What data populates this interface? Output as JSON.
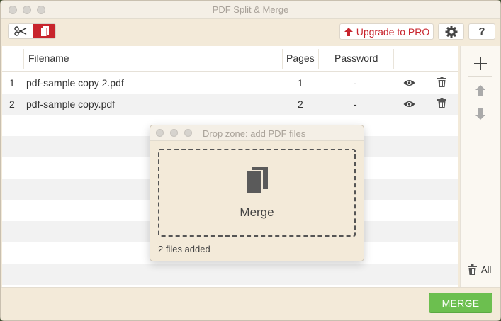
{
  "window": {
    "title": "PDF Split & Merge"
  },
  "toolbar": {
    "split_icon": "scissors-icon",
    "merge_icon": "documents-icon",
    "upgrade_label": "Upgrade to PRO",
    "upgrade_icon": "arrow-up-icon",
    "settings_icon": "gear-icon",
    "help_label": "?"
  },
  "table": {
    "columns": {
      "filename": "Filename",
      "pages": "Pages",
      "password": "Password"
    },
    "rows": [
      {
        "index": "1",
        "filename": "pdf-sample copy 2.pdf",
        "pages": "1",
        "password": "-"
      },
      {
        "index": "2",
        "filename": "pdf-sample copy.pdf",
        "pages": "2",
        "password": "-"
      }
    ]
  },
  "sidebar": {
    "add_icon": "plus-icon",
    "up_icon": "arrow-up-icon",
    "down_icon": "arrow-down-icon",
    "remove_all_label": "All"
  },
  "drop_zone": {
    "title": "Drop zone: add PDF files",
    "label": "Merge",
    "status": "2 files added"
  },
  "footer": {
    "merge_label": "MERGE"
  },
  "colors": {
    "accent_red": "#c8252d",
    "merge_green": "#6cbf4f",
    "background": "#f3ead9"
  }
}
